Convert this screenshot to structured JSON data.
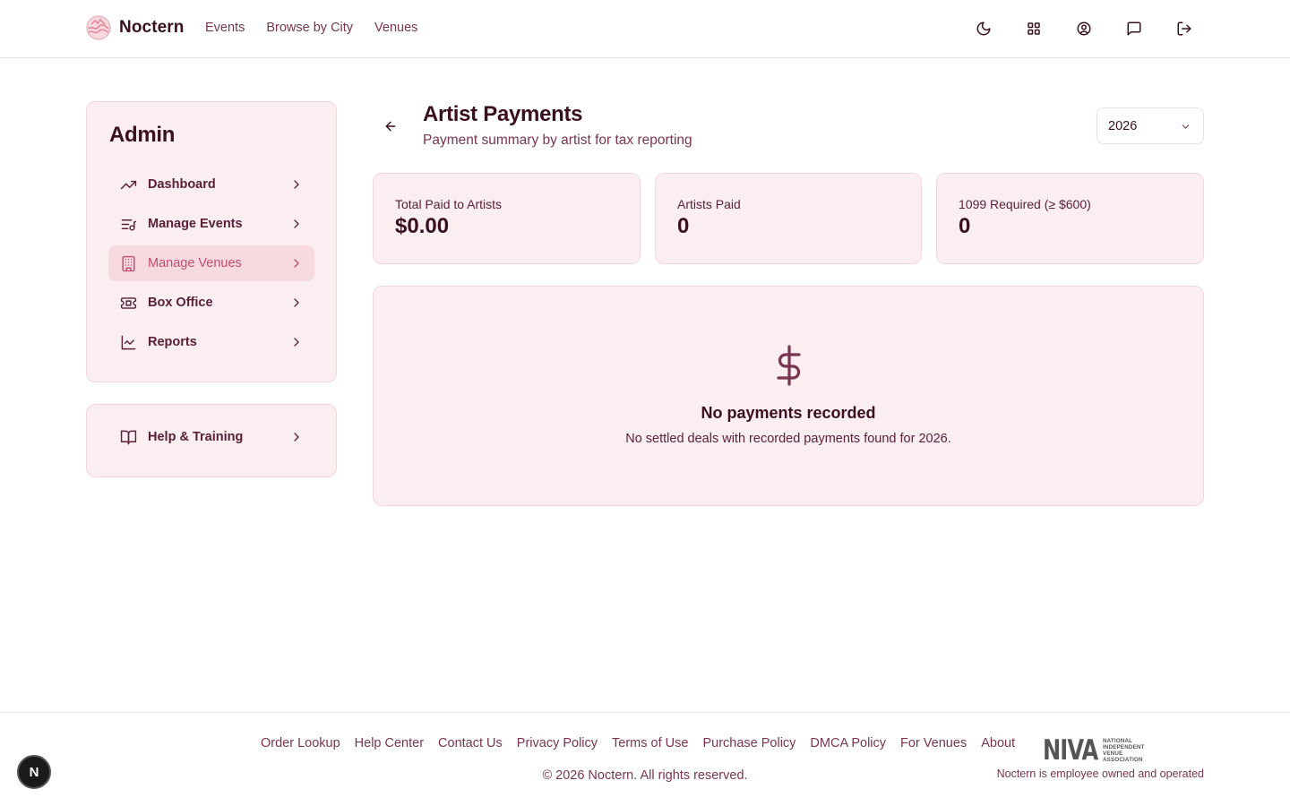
{
  "header": {
    "brand": "Noctern",
    "nav": [
      "Events",
      "Browse by City",
      "Venues"
    ],
    "icons": [
      "moon-icon",
      "grid-icon",
      "account-icon",
      "message-icon",
      "logout-icon"
    ]
  },
  "sidebar": {
    "title": "Admin",
    "items": [
      {
        "label": "Dashboard",
        "icon": "trending-up-icon",
        "active": false
      },
      {
        "label": "Manage Events",
        "icon": "list-music-icon",
        "active": false
      },
      {
        "label": "Manage Venues",
        "icon": "building-icon",
        "active": true
      },
      {
        "label": "Box Office",
        "icon": "ticket-icon",
        "active": false
      },
      {
        "label": "Reports",
        "icon": "line-chart-icon",
        "active": false
      }
    ],
    "help": {
      "label": "Help & Training",
      "icon": "book-icon"
    }
  },
  "main": {
    "title": "Artist Payments",
    "subtitle": "Payment summary by artist for tax reporting",
    "year": "2026",
    "stats": [
      {
        "label": "Total Paid to Artists",
        "value": "$0.00"
      },
      {
        "label": "Artists Paid",
        "value": "0"
      },
      {
        "label": "1099 Required (≥ $600)",
        "value": "0"
      }
    ],
    "empty": {
      "title": "No payments recorded",
      "message": "No settled deals with recorded payments found for 2026."
    }
  },
  "footer": {
    "links": [
      "Order Lookup",
      "Help Center",
      "Contact Us",
      "Privacy Policy",
      "Terms of Use",
      "Purchase Policy",
      "DMCA Policy",
      "For Venues",
      "About"
    ],
    "copyright": "© 2026 Noctern. All rights reserved.",
    "niva_logo": "NIVA",
    "niva_text": [
      "NATIONAL",
      "INDEPENDENT",
      "VENUE",
      "ASSOCIATION"
    ],
    "tagline": "Noctern is employee owned and operated"
  },
  "dev_badge": "N",
  "colors": {
    "accent": "#c24c72",
    "card_bg": "#fbeef1",
    "text_dark": "#3a0f1f",
    "text_muted": "#7a3550"
  }
}
